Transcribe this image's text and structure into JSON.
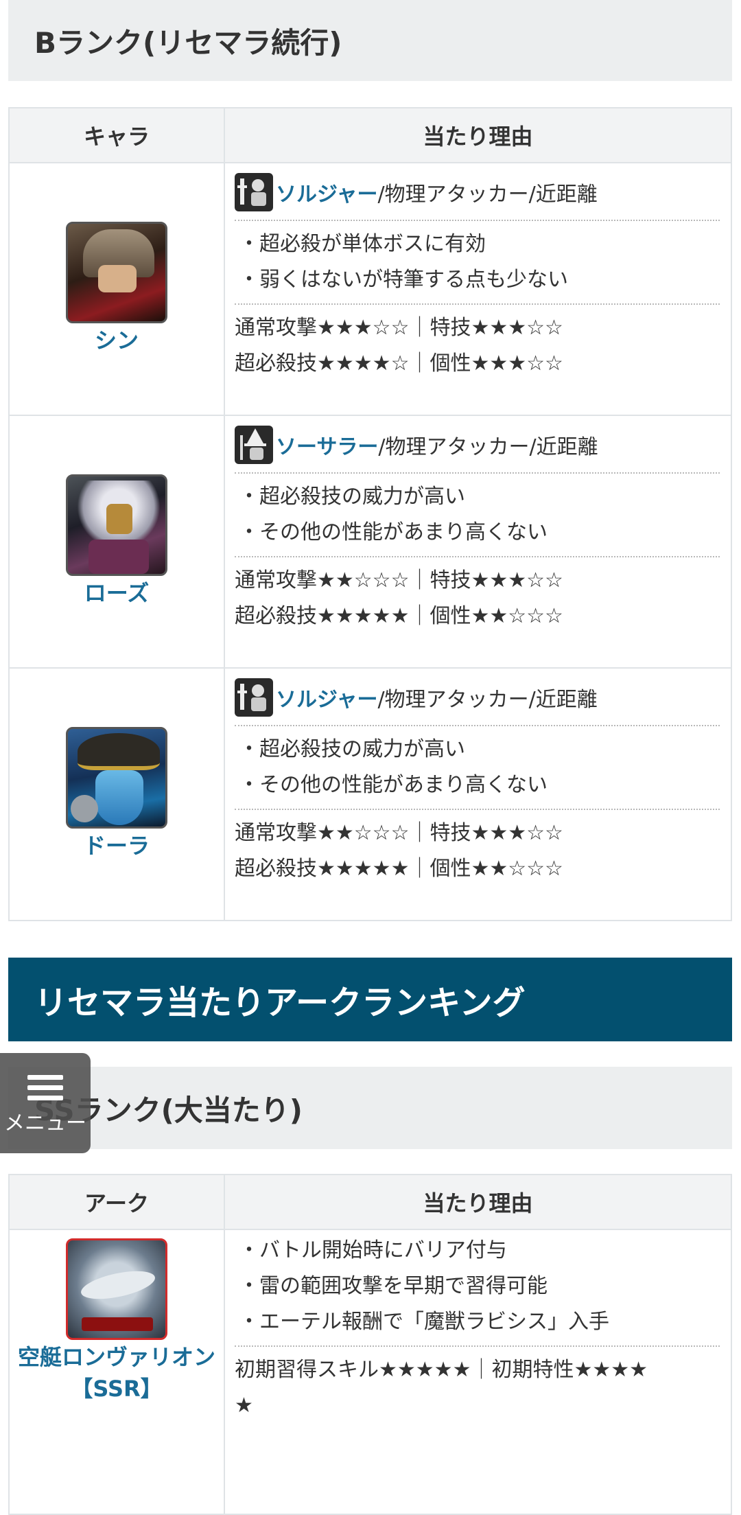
{
  "b_rank": {
    "heading": "Bランク(リセマラ続行)",
    "col_chara": "キャラ",
    "col_reason": "当たり理由",
    "rows": [
      {
        "name": "シン",
        "role_class": "ソルジャー",
        "role_rest": "/物理アタッカー/近距離",
        "role_icon": "soldier-icon",
        "points": [
          "・超必殺が単体ボスに有効",
          "・弱くはないが特筆する点も少ない"
        ],
        "stat_line1": "通常攻撃★★★☆☆｜特技★★★☆☆",
        "stat_line2": "超必殺技★★★★☆｜個性★★★☆☆"
      },
      {
        "name": "ローズ",
        "role_class": "ソーサラー",
        "role_rest": "/物理アタッカー/近距離",
        "role_icon": "sorcerer-icon",
        "points": [
          "・超必殺技の威力が高い",
          "・その他の性能があまり高くない"
        ],
        "stat_line1": "通常攻撃★★☆☆☆｜特技★★★☆☆",
        "stat_line2": "超必殺技★★★★★｜個性★★☆☆☆"
      },
      {
        "name": "ドーラ",
        "role_class": "ソルジャー",
        "role_rest": "/物理アタッカー/近距離",
        "role_icon": "soldier-icon",
        "points": [
          "・超必殺技の威力が高い",
          "・その他の性能があまり高くない"
        ],
        "stat_line1": "通常攻撃★★☆☆☆｜特技★★★☆☆",
        "stat_line2": "超必殺技★★★★★｜個性★★☆☆☆"
      }
    ]
  },
  "ark_section": {
    "heading": "リセマラ当たりアークランキング",
    "ss_heading": "SSランク(大当たり)",
    "col_ark": "アーク",
    "col_reason": "当たり理由",
    "row": {
      "name": "空艇ロンヴァリオン",
      "rarity": "【SSR】",
      "points": [
        "・バトル開始時にバリア付与",
        "・雷の範囲攻撃を早期で習得可能",
        "・エーテル報酬で「魔獣ラビシス」入手"
      ],
      "stat_line1": "初期習得スキル★★★★★｜初期特性★★★★",
      "stat_line2": "★"
    }
  },
  "menu": {
    "label": "メニュー"
  },
  "colors": {
    "accent": "#03506f",
    "link": "#1a6c97",
    "header_bg": "#eceeef"
  }
}
